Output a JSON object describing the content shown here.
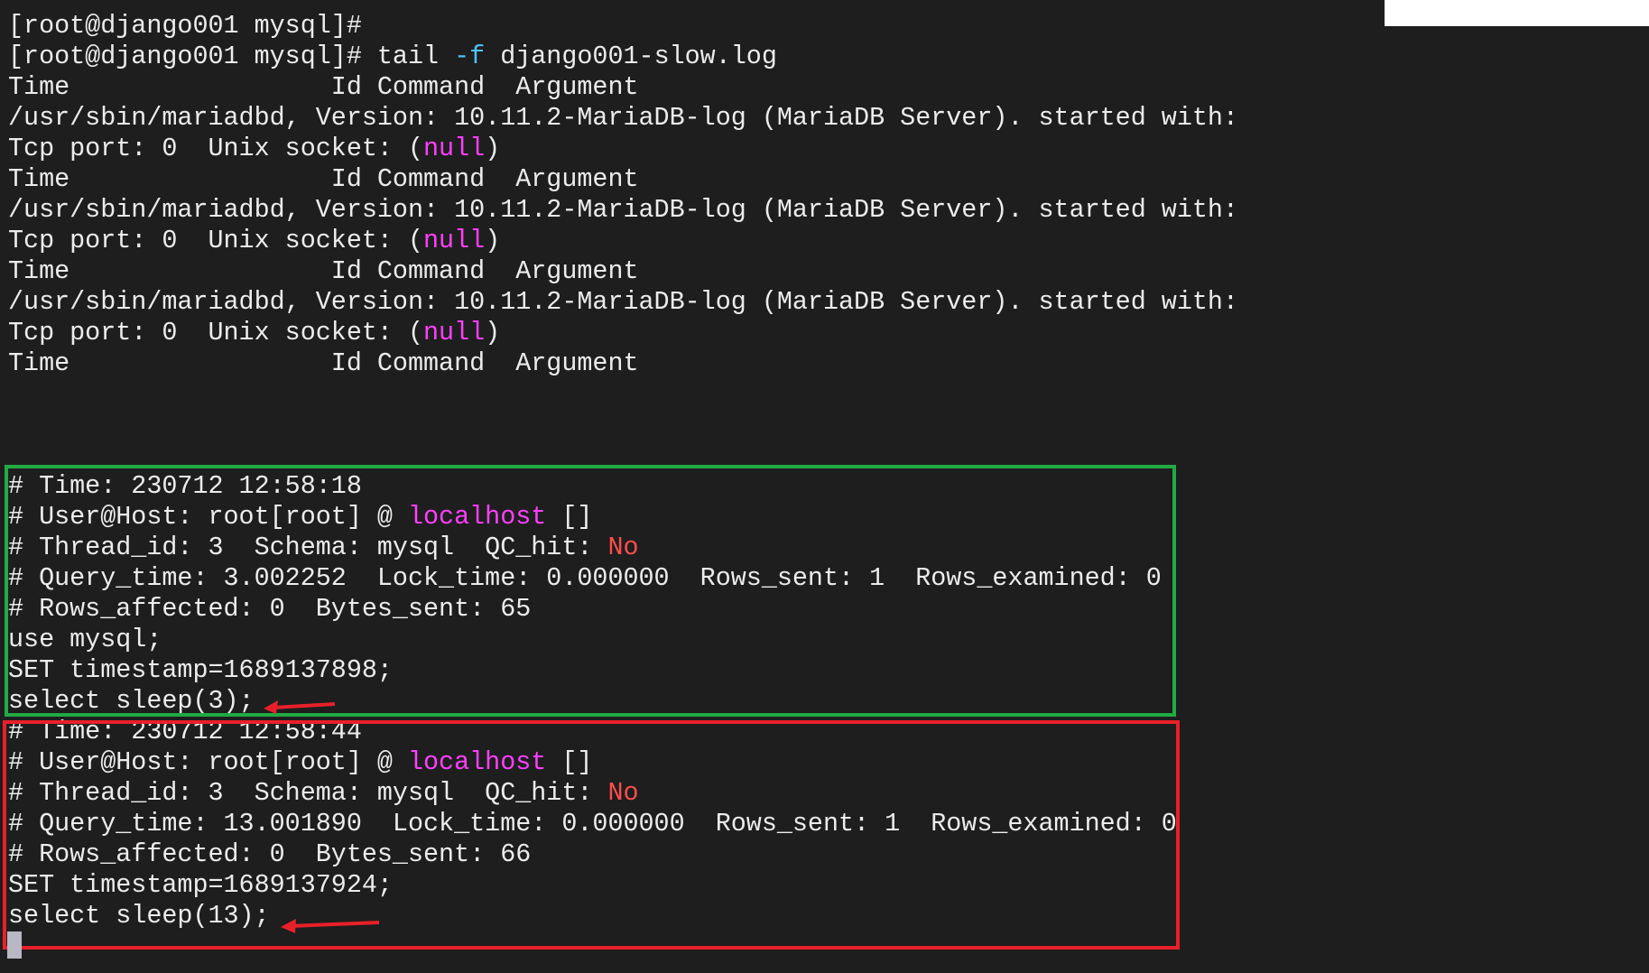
{
  "colors": {
    "background": "#1e1e1e",
    "text": "#ececec",
    "option": "#4fc3f7",
    "null": "#ff3fff",
    "host": "#ff3fff",
    "no": "#ff4d4d",
    "highlight_first": "#22aa44",
    "highlight_second": "#e8202a",
    "arrow": "#e8202a"
  },
  "terminal": {
    "lines": [
      [
        {
          "t": "[root@django001 mysql]#"
        }
      ],
      [
        {
          "t": "[root@django001 mysql]# tail "
        },
        {
          "t": "-f",
          "c": "option"
        },
        {
          "t": " django001-slow.log"
        }
      ],
      [
        {
          "t": "Time                 Id Command  Argument"
        }
      ],
      [
        {
          "t": "/usr/sbin/mariadbd, Version: 10.11.2-MariaDB-log (MariaDB Server). started with:"
        }
      ],
      [
        {
          "t": "Tcp port: 0  Unix socket: ("
        },
        {
          "t": "null",
          "c": "null"
        },
        {
          "t": ")"
        }
      ],
      [
        {
          "t": "Time                 Id Command  Argument"
        }
      ],
      [
        {
          "t": "/usr/sbin/mariadbd, Version: 10.11.2-MariaDB-log (MariaDB Server). started with:"
        }
      ],
      [
        {
          "t": "Tcp port: 0  Unix socket: ("
        },
        {
          "t": "null",
          "c": "null"
        },
        {
          "t": ")"
        }
      ],
      [
        {
          "t": "Time                 Id Command  Argument"
        }
      ],
      [
        {
          "t": "/usr/sbin/mariadbd, Version: 10.11.2-MariaDB-log (MariaDB Server). started with:"
        }
      ],
      [
        {
          "t": "Tcp port: 0  Unix socket: ("
        },
        {
          "t": "null",
          "c": "null"
        },
        {
          "t": ")"
        }
      ],
      [
        {
          "t": "Time                 Id Command  Argument"
        }
      ],
      [],
      [],
      [],
      [
        {
          "t": "# Time: 230712 12:58:18"
        }
      ],
      [
        {
          "t": "# User@Host: root[root] @ "
        },
        {
          "t": "localhost",
          "c": "host"
        },
        {
          "t": " []"
        }
      ],
      [
        {
          "t": "# Thread_id: 3  Schema: mysql  QC_hit: "
        },
        {
          "t": "No",
          "c": "no"
        }
      ],
      [
        {
          "t": "# Query_time: 3.002252  Lock_time: 0.000000  Rows_sent: 1  Rows_examined: 0"
        }
      ],
      [
        {
          "t": "# Rows_affected: 0  Bytes_sent: 65"
        }
      ],
      [
        {
          "t": "use mysql;"
        }
      ],
      [
        {
          "t": "SET timestamp=1689137898;"
        }
      ],
      [
        {
          "t": "select sleep(3);"
        }
      ],
      [
        {
          "t": "# Time: 230712 12:58:44"
        }
      ],
      [
        {
          "t": "# User@Host: root[root] @ "
        },
        {
          "t": "localhost",
          "c": "host"
        },
        {
          "t": " []"
        }
      ],
      [
        {
          "t": "# Thread_id: 3  Schema: mysql  QC_hit: "
        },
        {
          "t": "No",
          "c": "no"
        }
      ],
      [
        {
          "t": "# Query_time: 13.001890  Lock_time: 0.000000  Rows_sent: 1  Rows_examined: 0"
        }
      ],
      [
        {
          "t": "# Rows_affected: 0  Bytes_sent: 66"
        }
      ],
      [
        {
          "t": "SET timestamp=1689137924;"
        }
      ],
      [
        {
          "t": "select sleep(13);"
        }
      ]
    ]
  }
}
